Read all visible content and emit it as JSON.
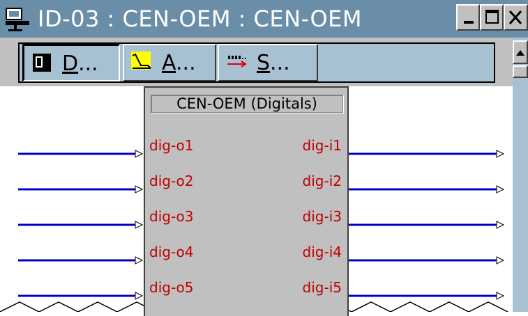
{
  "window": {
    "title": "ID-03 : CEN-OEM : CEN-OEM",
    "caption_buttons": [
      "minimize",
      "maximize",
      "close"
    ]
  },
  "toolbar": {
    "buttons": [
      {
        "label_accel": "D",
        "label_rest": "...",
        "icon": "digital-block-icon",
        "pressed": true
      },
      {
        "label_accel": "A",
        "label_rest": "...",
        "icon": "analog-signal-icon",
        "pressed": false
      },
      {
        "label_accel": "S",
        "label_rest": "...",
        "icon": "serial-signal-icon",
        "pressed": false
      }
    ]
  },
  "block": {
    "title": "CEN-OEM (Digitals)",
    "left_pins": [
      "dig-o1",
      "dig-o2",
      "dig-o3",
      "dig-o4",
      "dig-o5"
    ],
    "right_pins": [
      "dig-i1",
      "dig-i2",
      "dig-i3",
      "dig-i4",
      "dig-i5"
    ]
  },
  "colors": {
    "title_bar": "#6b8ea8",
    "toolbar_strip": "#a7c0d2",
    "block_fill": "#c0c0c0",
    "wire": "#0000cc",
    "pin_label": "#c00000"
  }
}
